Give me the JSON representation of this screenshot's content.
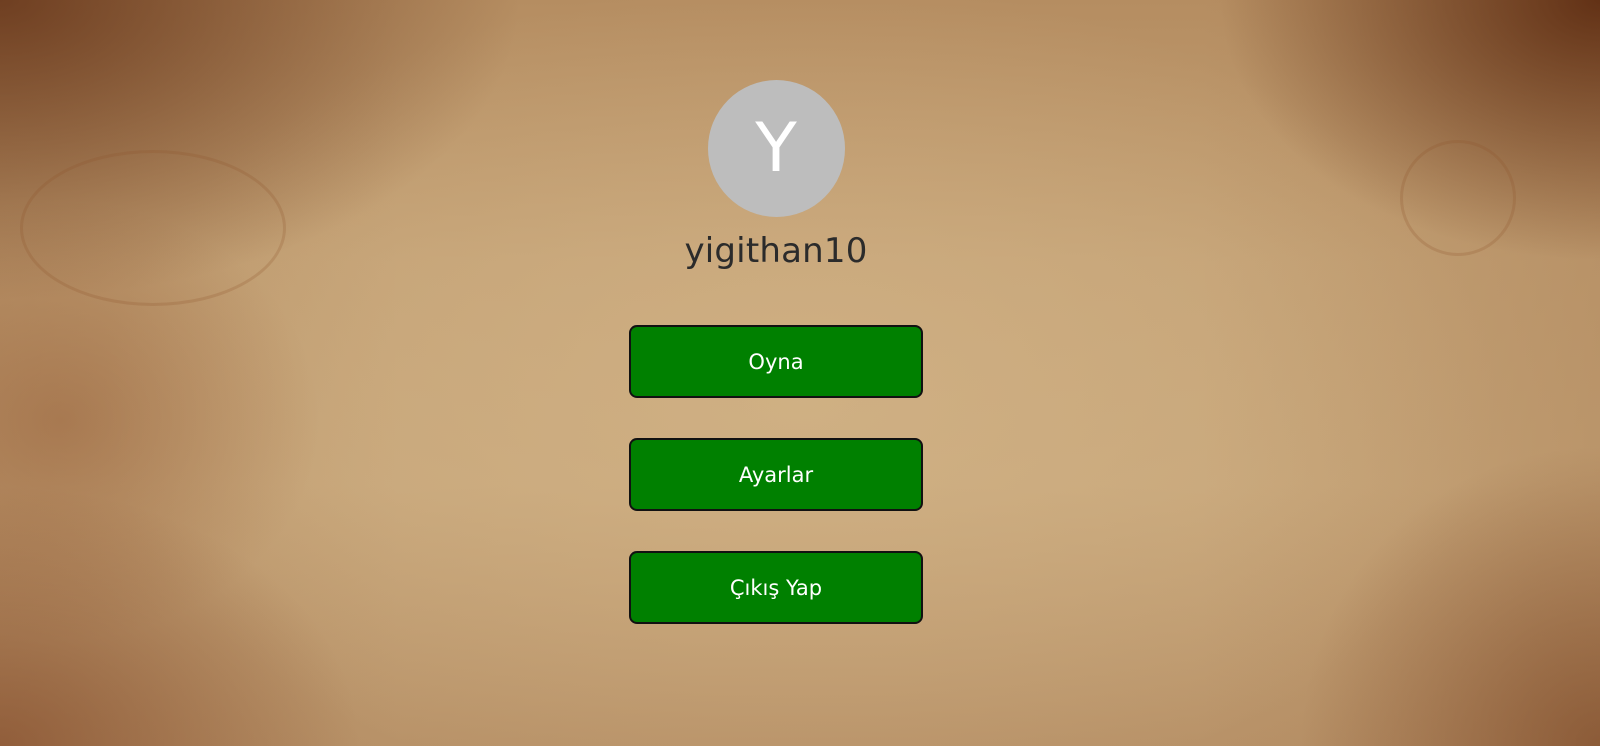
{
  "profile": {
    "avatar_initial": "Y",
    "username": "yigithan10",
    "avatar_color": "#bdbdbd"
  },
  "menu": {
    "play_label": "Oyna",
    "settings_label": "Ayarlar",
    "logout_label": "Çıkış Yap",
    "button_color": "#008000"
  }
}
